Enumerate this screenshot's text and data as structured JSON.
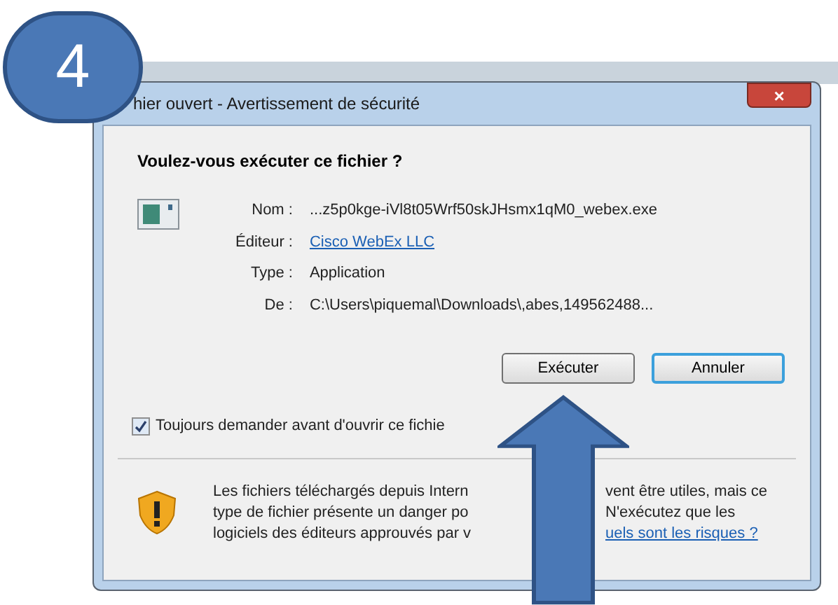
{
  "badge": {
    "text": "4"
  },
  "window": {
    "title": "hier ouvert - Avertissement de sécurité",
    "close": "×"
  },
  "question": "Voulez-vous exécuter ce fichier ?",
  "details": [
    {
      "label": "Nom :",
      "value": "...z5p0kge-iVl8t05Wrf50skJHsmx1qM0_webex.exe",
      "kind": "text"
    },
    {
      "label": "Éditeur :",
      "value": "Cisco WebEx LLC",
      "kind": "link"
    },
    {
      "label": "Type :",
      "value": "Application",
      "kind": "text"
    },
    {
      "label": "De :",
      "value": "C:\\Users\\piquemal\\Downloads\\,abes,149562488...",
      "kind": "text"
    }
  ],
  "buttons": [
    {
      "label": "Exécuter",
      "selected": false
    },
    {
      "label": "Annuler",
      "selected": true
    }
  ],
  "always_ask": {
    "label": "Toujours demander avant d'ouvrir ce fichie",
    "checked": true
  },
  "warning_lines": [
    {
      "left": "Les fichiers téléchargés depuis Intern",
      "right": "vent être utiles, mais ce",
      "kind": "text"
    },
    {
      "left": "type de fichier présente un danger po",
      "right": "N'exécutez que les",
      "kind": "text"
    },
    {
      "left": "logiciels des éditeurs approuvés par v",
      "right": "uels sont les risques ?",
      "kind": "link"
    }
  ]
}
